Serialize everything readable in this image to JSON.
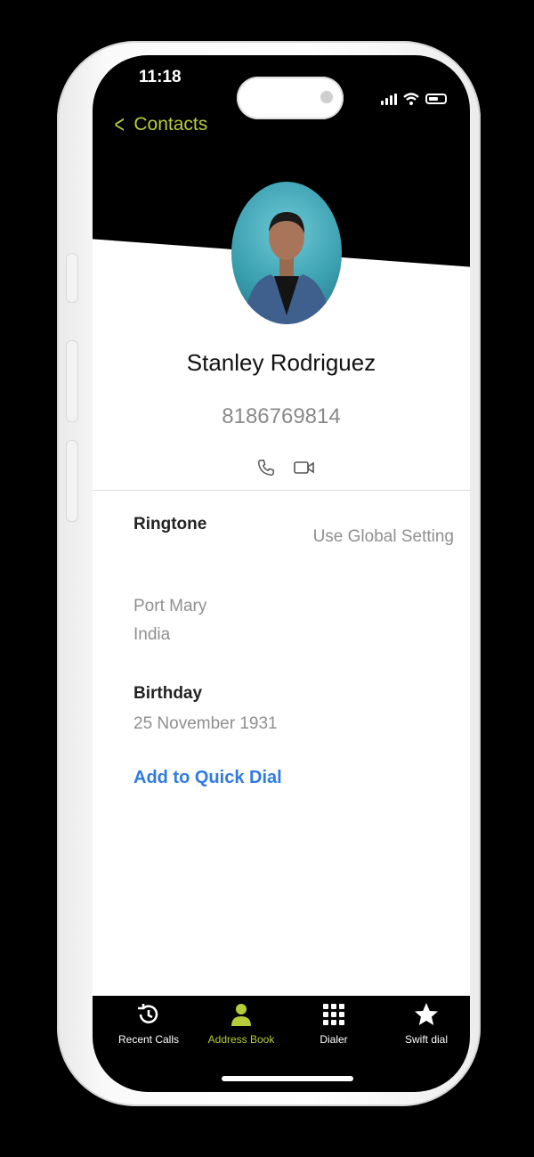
{
  "status": {
    "time": "11:18"
  },
  "nav": {
    "back_label": "Contacts"
  },
  "contact": {
    "name": "Stanley Rodriguez",
    "phone": "8186769814",
    "ringtone_label": "Ringtone",
    "ringtone_value": "Use Global Setting",
    "address_line1": "Port Mary",
    "address_line2": "India",
    "birthday_label": "Birthday",
    "birthday_value": "25 November 1931",
    "quick_dial_label": "Add to Quick Dial"
  },
  "tabs": [
    {
      "label": "Recent Calls",
      "icon": "history-icon"
    },
    {
      "label": "Address Book",
      "icon": "person-icon",
      "active": true
    },
    {
      "label": "Dialer",
      "icon": "keypad-icon"
    },
    {
      "label": "Swift dial",
      "icon": "star-icon"
    }
  ],
  "colors": {
    "accent": "#b7cc3a",
    "link": "#2f7be0",
    "background": "#000000"
  }
}
